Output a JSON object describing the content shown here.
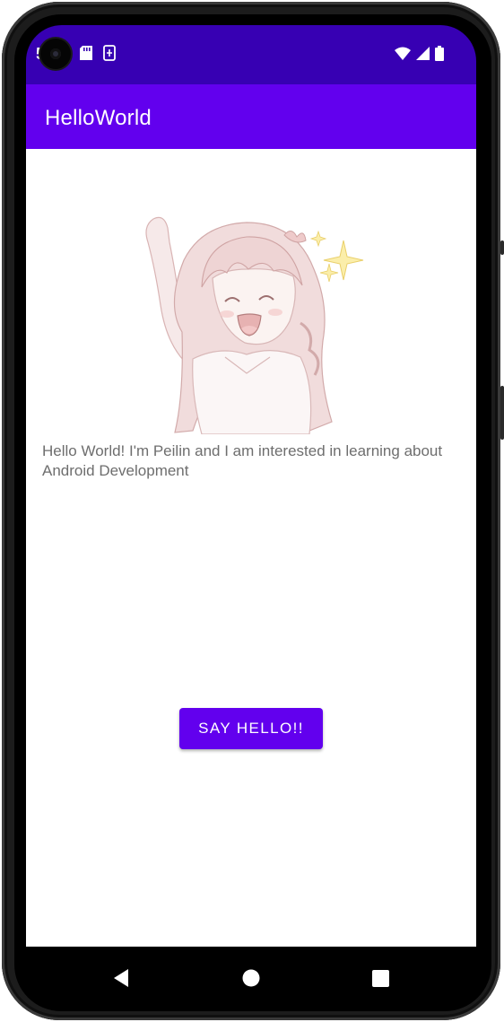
{
  "status_bar": {
    "time": "5",
    "background_color": "#3700b3",
    "left_icons": [
      "sd-card-icon",
      "sim-icon"
    ],
    "right_icons": [
      "wifi-icon",
      "cellular-signal-icon",
      "battery-icon"
    ]
  },
  "app_bar": {
    "title": "HelloWorld",
    "background_color": "#6200ee"
  },
  "main": {
    "image": "anime-girl-cheering-illustration",
    "intro_text": "Hello World! I'm Peilin and I am interested in learning about Android Development",
    "button_label": "SAY HELLO!!",
    "button_color": "#6200ee"
  },
  "nav_bar": {
    "buttons": [
      "back-icon",
      "home-icon",
      "recents-icon"
    ]
  }
}
